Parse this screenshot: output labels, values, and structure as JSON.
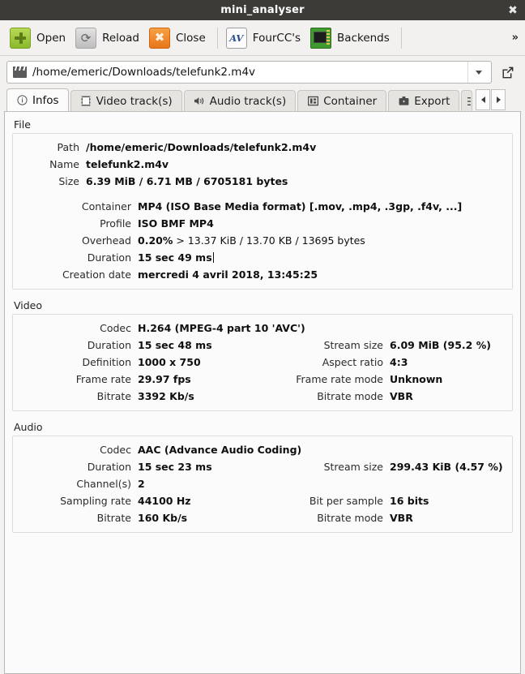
{
  "window": {
    "title": "mini_analyser",
    "close_icon": "close-icon"
  },
  "toolbar": {
    "buttons": [
      {
        "label": "Open",
        "icon": "open-icon"
      },
      {
        "label": "Reload",
        "icon": "reload-icon"
      },
      {
        "label": "Close",
        "icon": "close-file-icon"
      },
      {
        "label": "FourCC's",
        "icon": "av-icon"
      },
      {
        "label": "Backends",
        "icon": "chip-icon"
      }
    ],
    "overflow_label": "»"
  },
  "pathbar": {
    "value": "/home/emeric/Downloads/telefunk2.m4v",
    "placeholder": "/home/emeric/Downloads/telefunk2.m4v",
    "dropdown_icon": "chevron-down-icon",
    "open_external_icon": "external-link-icon",
    "file_icon": "clapperboard-icon"
  },
  "tabs": {
    "items": [
      {
        "label": "Infos",
        "icon": "info-icon",
        "active": true
      },
      {
        "label": "Video track(s)",
        "icon": "film-icon",
        "active": false
      },
      {
        "label": "Audio track(s)",
        "icon": "speaker-icon",
        "active": false
      },
      {
        "label": "Container",
        "icon": "box-icon",
        "active": false
      },
      {
        "label": "Export",
        "icon": "export-icon",
        "active": false
      }
    ],
    "clipped_label": "",
    "scroll_left_icon": "chevron-left-icon",
    "scroll_right_icon": "chevron-right-icon"
  },
  "sections": {
    "file": {
      "title": "File",
      "rows_a": [
        {
          "label": "Path",
          "value": "/home/emeric/Downloads/telefunk2.m4v"
        },
        {
          "label": "Name",
          "value": "telefunk2.m4v"
        },
        {
          "label": "Size",
          "value": "6.39 MiB  /  6.71 MB  /  6705181 bytes"
        }
      ],
      "rows_b": [
        {
          "label": "Container",
          "value": "MP4 (ISO Base Media format) [.mov, .mp4, .3gp, .f4v, ...]"
        },
        {
          "label": "Profile",
          "value": "ISO BMF MP4"
        },
        {
          "label": "Overhead",
          "value_bold": "0.20%",
          "value_normal": " > 13.37 KiB / 13.70 KB / 13695 bytes"
        },
        {
          "label": "Duration",
          "value": "15 sec 49 ms",
          "cursor": true
        },
        {
          "label": "Creation date",
          "value": "mercredi 4 avril 2018, 13:45:25"
        }
      ]
    },
    "video": {
      "title": "Video",
      "rows": [
        {
          "label": "Codec",
          "value": "H.264 (MPEG-4 part 10 'AVC')",
          "label2": "",
          "value2": ""
        },
        {
          "label": "Duration",
          "value": "15 sec 48 ms",
          "label2": "Stream size",
          "value2": "6.09 MiB (95.2 %)"
        },
        {
          "label": "Definition",
          "value": "1000 x 750",
          "label2": "Aspect ratio",
          "value2": "4:3"
        },
        {
          "label": "Frame rate",
          "value": "29.97 fps",
          "label2": "Frame rate mode",
          "value2": "Unknown"
        },
        {
          "label": "Bitrate",
          "value": "3392 Kb/s",
          "label2": "Bitrate mode",
          "value2": "VBR"
        }
      ]
    },
    "audio": {
      "title": "Audio",
      "rows": [
        {
          "label": "Codec",
          "value": "AAC (Advance Audio Coding)",
          "label2": "",
          "value2": ""
        },
        {
          "label": "Duration",
          "value": "15 sec 23 ms",
          "label2": "Stream size",
          "value2": "299.43 KiB (4.57 %)"
        },
        {
          "label": "Channel(s)",
          "value": "2",
          "label2": "",
          "value2": ""
        },
        {
          "label": "Sampling rate",
          "value": "44100 Hz",
          "label2": "Bit per sample",
          "value2": "16 bits"
        },
        {
          "label": "Bitrate",
          "value": "160 Kb/s",
          "label2": "Bitrate mode",
          "value2": "VBR"
        }
      ]
    }
  },
  "colors": {
    "titlebar_bg": "#3c3b37",
    "toolbar_bg": "#f2f1f0",
    "content_bg": "#fbfbfb",
    "accent_green": "#8ab82b",
    "accent_orange": "#e8751a"
  }
}
